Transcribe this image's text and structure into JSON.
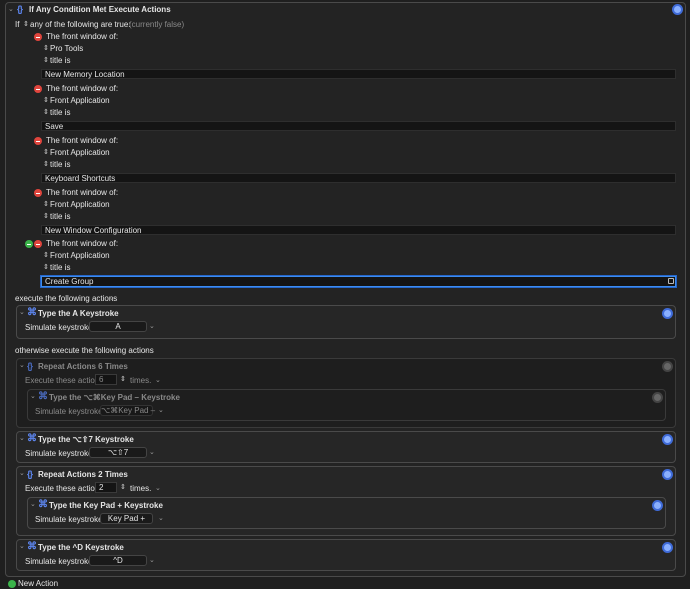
{
  "main_action": {
    "title": "If Any Condition Met Execute Actions",
    "if_label": "If",
    "mode": "any of the following are true:",
    "state": "(currently false)"
  },
  "conditions": [
    {
      "header": "The front window of:",
      "app": "Pro Tools",
      "comparator": "title is",
      "value": "New Memory Location"
    },
    {
      "header": "The front window of:",
      "app": "Front Application",
      "comparator": "title is",
      "value": "Save"
    },
    {
      "header": "The front window of:",
      "app": "Front Application",
      "comparator": "title is",
      "value": "Keyboard Shortcuts"
    },
    {
      "header": "The front window of:",
      "app": "Front Application",
      "comparator": "title is",
      "value": "New Window Configuration"
    },
    {
      "header": "The front window of:",
      "app": "Front Application",
      "comparator": "title is",
      "value": "Create Group"
    }
  ],
  "execute_label": "execute the following actions",
  "otherwise_label": "otherwise execute the following actions",
  "simulate_label": "Simulate keystroke:",
  "execute_these_label": "Execute these actions",
  "times_label": "times.",
  "then_actions": [
    {
      "title": "Type the A Keystroke",
      "keystroke": "A"
    }
  ],
  "else_actions": {
    "repeat_disabled": {
      "title": "Repeat Actions 6 Times",
      "count": "6",
      "inner": {
        "title": "Type the ⌥⌘Key Pad – Keystroke",
        "keystroke": "⌥⌘Key Pad –"
      }
    },
    "type_opt_shift_7": {
      "title": "Type the ⌥⇧7 Keystroke",
      "keystroke": "⌥⇧7"
    },
    "repeat_2": {
      "title": "Repeat Actions 2 Times",
      "count": "2",
      "inner": {
        "title": "Type the Key Pad + Keystroke",
        "keystroke": "Key Pad +"
      }
    },
    "type_ctrl_d": {
      "title": "Type the ^D Keystroke",
      "keystroke": "^D"
    }
  },
  "footer": {
    "new_action": "New Action"
  },
  "colors": {
    "accent": "#5d86f0",
    "remove": "#e0453d",
    "add": "#3bb44a",
    "focus": "#3c8cf0"
  }
}
